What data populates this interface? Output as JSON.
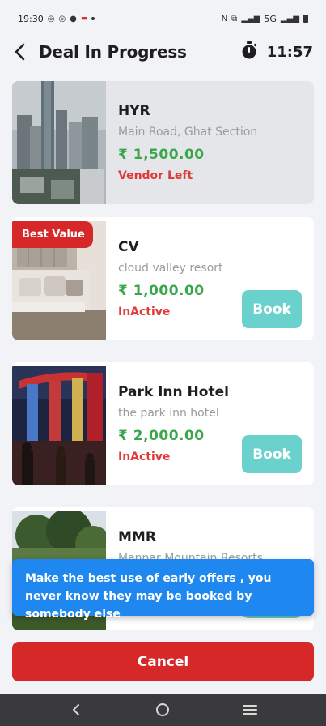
{
  "status_bar": {
    "time": "19:30",
    "network": "5G"
  },
  "header": {
    "title": "Deal In Progress",
    "timer": "11:57",
    "back_icon": "back-arrow-icon",
    "timer_icon": "stopwatch-icon"
  },
  "deals": [
    {
      "name": "HYR",
      "address": "Main Road, Ghat Section",
      "price": "₹ 1,500.00",
      "status": "Vendor Left",
      "badge": "",
      "book_label": "",
      "image": "city-skyline-photo"
    },
    {
      "name": "CV",
      "address": "cloud valley resort",
      "price": "₹ 1,000.00",
      "status": "InActive",
      "badge": "Best Value",
      "book_label": "Book",
      "image": "hotel-room-photo"
    },
    {
      "name": "Park Inn Hotel",
      "address": "the park inn hotel",
      "price": "₹ 2,000.00",
      "status": "InActive",
      "badge": "",
      "book_label": "Book",
      "image": "night-towers-photo"
    },
    {
      "name": "MMR",
      "address": "Mannar Mountain Resorts",
      "price": "",
      "status": "",
      "badge": "",
      "book_label": "",
      "image": "mountain-resort-photo"
    }
  ],
  "toast": {
    "message": "Make the best use of early offers , you never know they may be booked by somebody else"
  },
  "cancel_label": "Cancel",
  "nav_bar": {
    "back": "nav-back-icon",
    "home": "nav-home-icon",
    "recents": "nav-recents-icon"
  },
  "colors": {
    "accent_red": "#d62828",
    "price_green": "#3aa64c",
    "status_red": "#e03a3a",
    "book_teal": "#6ad1cc",
    "toast_blue": "#1e88f0"
  }
}
